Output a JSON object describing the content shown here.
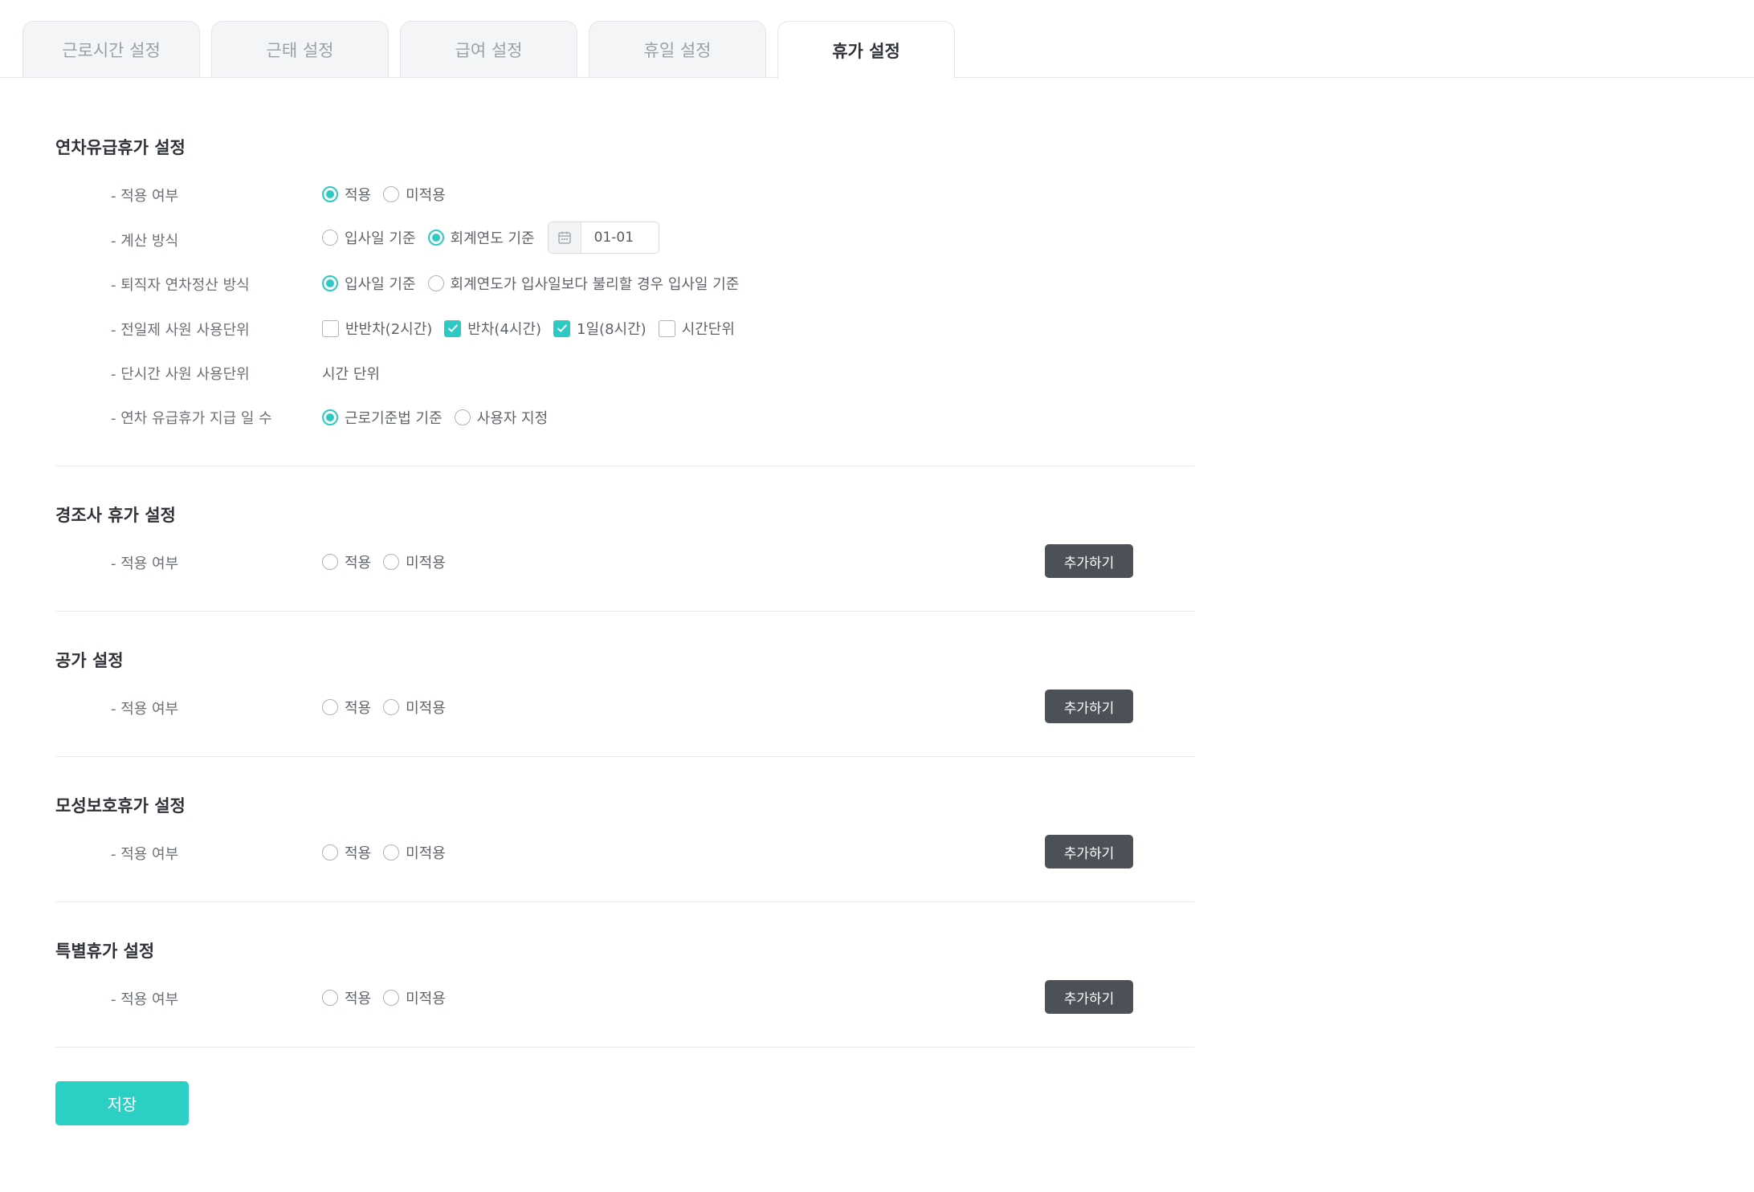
{
  "tabs": [
    {
      "label": "근로시간 설정",
      "active": false
    },
    {
      "label": "근태 설정",
      "active": false
    },
    {
      "label": "급여 설정",
      "active": false
    },
    {
      "label": "휴일 설정",
      "active": false
    },
    {
      "label": "휴가 설정",
      "active": true
    }
  ],
  "annual": {
    "title": "연차유급휴가 설정",
    "apply": {
      "label": "- 적용 여부",
      "opt1": "적용",
      "opt2": "미적용",
      "selected": "적용"
    },
    "calc": {
      "label": "- 계산 방식",
      "opt1": "입사일 기준",
      "opt2": "회계연도 기준",
      "selected": "회계연도 기준",
      "date_value": "01-01",
      "date_icon": "calendar-icon"
    },
    "retire": {
      "label": "- 퇴직자 연차정산 방식",
      "opt1": "입사일 기준",
      "opt2": "회계연도가 입사일보다 불리할 경우 입사일 기준",
      "selected": "입사일 기준"
    },
    "fulltime_unit": {
      "label": "- 전일제 사원 사용단위",
      "opt1": "반반차(2시간)",
      "opt2": "반차(4시간)",
      "opt3": "1일(8시간)",
      "opt4": "시간단위",
      "checked": [
        "반차(4시간)",
        "1일(8시간)"
      ]
    },
    "parttime_unit": {
      "label": "- 단시간 사원 사용단위",
      "value": "시간 단위"
    },
    "days": {
      "label": "- 연차 유급휴가 지급 일 수",
      "opt1": "근로기준법 기준",
      "opt2": "사용자 지정",
      "selected": "근로기준법 기준"
    }
  },
  "condolence": {
    "title": "경조사 휴가 설정",
    "apply_label": "- 적용 여부",
    "opt1": "적용",
    "opt2": "미적용",
    "add_label": "추가하기"
  },
  "official": {
    "title": "공가 설정",
    "apply_label": "- 적용 여부",
    "opt1": "적용",
    "opt2": "미적용",
    "add_label": "추가하기"
  },
  "maternity": {
    "title": "모성보호휴가 설정",
    "apply_label": "- 적용 여부",
    "opt1": "적용",
    "opt2": "미적용",
    "add_label": "추가하기"
  },
  "special": {
    "title": "특별휴가 설정",
    "apply_label": "- 적용 여부",
    "opt1": "적용",
    "opt2": "미적용",
    "add_label": "추가하기"
  },
  "save_label": "저장",
  "colors": {
    "accent": "#2ccac2",
    "button_dark": "#4b5157",
    "save": "#2ccfc3"
  }
}
